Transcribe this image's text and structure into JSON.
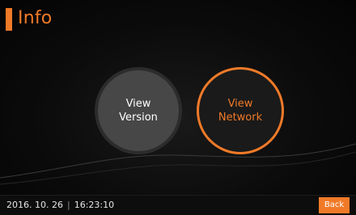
{
  "header": {
    "title": "Info"
  },
  "buttons": {
    "view_version": "View\nVersion",
    "view_network": "View\nNetwork"
  },
  "footer": {
    "date": "2016. 10. 26",
    "separator": "|",
    "time": "16:23:10",
    "back_label": "Back"
  },
  "colors": {
    "accent": "#f07a28",
    "background": "#050505",
    "secondary_button": "#474747"
  }
}
